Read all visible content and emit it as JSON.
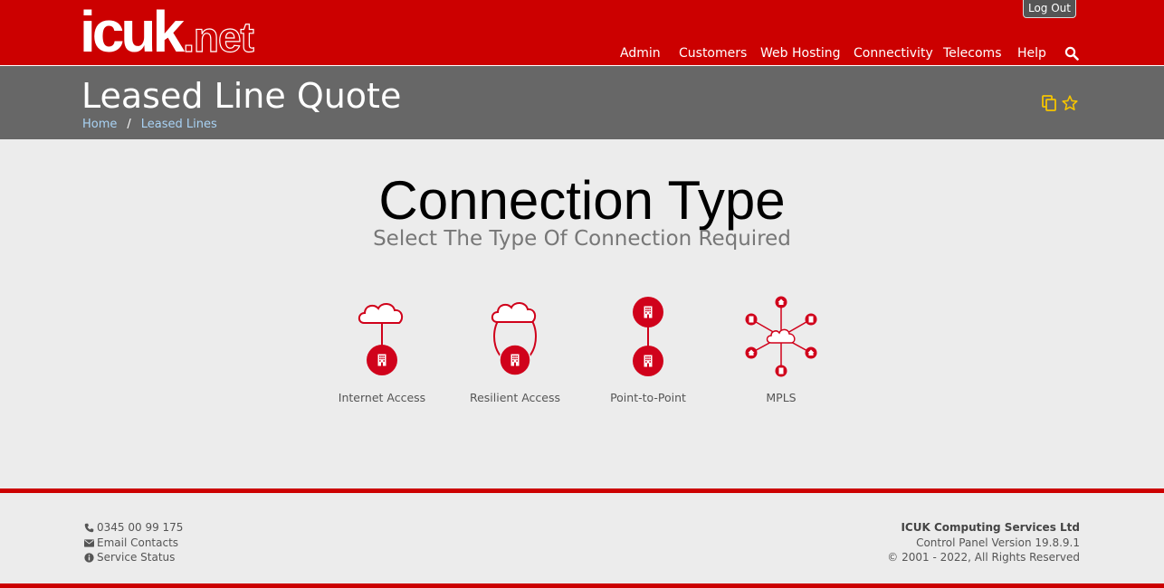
{
  "header": {
    "logo_main": "icuk",
    "logo_suffix": ".net",
    "logout_label": "Log Out",
    "nav": [
      "Admin",
      "Customers",
      "Web Hosting",
      "Connectivity",
      "Telecoms",
      "Help"
    ]
  },
  "title_bar": {
    "title": "Leased Line Quote",
    "breadcrumb": [
      "Home",
      "Leased Lines"
    ],
    "breadcrumb_separator": "/"
  },
  "main": {
    "heading": "Connection Type",
    "subheading": "Select The Type Of Connection Required",
    "options": [
      "Internet Access",
      "Resilient Access",
      "Point-to-Point",
      "MPLS"
    ]
  },
  "footer": {
    "phone": "0345 00 99 175",
    "email": "Email Contacts",
    "status": "Service Status",
    "company": "ICUK Computing Services Ltd",
    "version": "Control Panel Version 19.8.9.1",
    "copyright": "© 2001 - 2022, All Rights Reserved"
  },
  "colors": {
    "brand_red": "#cc0000",
    "title_band": "#676767",
    "icon_accent": "#f5c400",
    "link_blue": "#a9d3f5"
  }
}
